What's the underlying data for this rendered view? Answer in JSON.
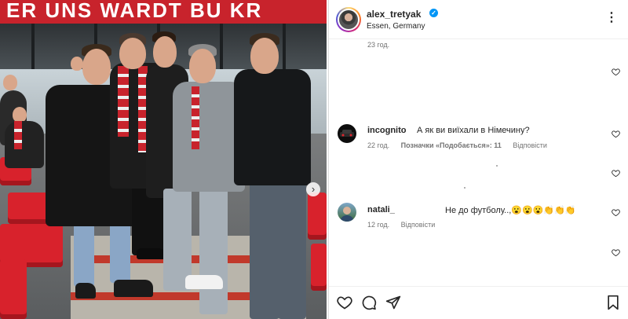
{
  "photo": {
    "banner_text": "ER UNS WARDT BU KR",
    "next_glyph": "›"
  },
  "post": {
    "username": "alex_tretyak",
    "location": "Essen, Germany",
    "verified_glyph": "✓",
    "more_glyph": "⋮"
  },
  "comments": {
    "top_time": "23 год.",
    "items": [
      {
        "user": "incognito",
        "text": "А як ви виїхали в Німечину?",
        "time": "22 год.",
        "likes": "Позначки «Подобається»: 11",
        "reply": "Відповісти"
      },
      {
        "user": "natali_",
        "text": "Не до футболу..,😮😮😮👏👏👏",
        "time": "12 год.",
        "reply": "Відповісти"
      }
    ]
  },
  "icons": {
    "heart": "heart-outline",
    "comment": "comment-bubble",
    "share": "paper-plane",
    "save": "bookmark"
  },
  "colors": {
    "verified": "#0095f6",
    "banner": "#c8232c",
    "muted_text": "#737373"
  }
}
